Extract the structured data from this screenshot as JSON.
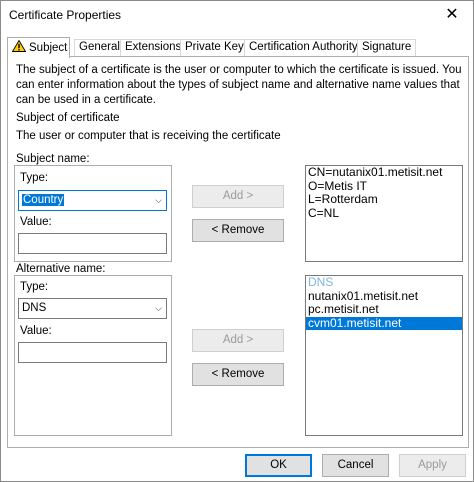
{
  "window": {
    "title": "Certificate Properties",
    "close_glyph": "✕"
  },
  "tabs": [
    {
      "label": "Subject",
      "active": true
    },
    {
      "label": "General"
    },
    {
      "label": "Extensions"
    },
    {
      "label": "Private Key"
    },
    {
      "label": "Certification Authority"
    },
    {
      "label": "Signature"
    }
  ],
  "subject": {
    "description_lines": [
      "The subject of a certificate is the user or computer to which the certificate is issued. You",
      "can enter information about the types of subject name and alternative name values that",
      "can be used in a certificate."
    ],
    "section_title": "Subject of certificate",
    "section_subtitle": "The user or computer that is receiving the certificate",
    "subject_name": {
      "label": "Subject name:",
      "type_label": "Type:",
      "type_value": "Country",
      "value_label": "Value:",
      "value": "",
      "add_button": "Add >",
      "remove_button": "< Remove",
      "entries": [
        "CN=nutanix01.metisit.net",
        "O=Metis IT",
        "L=Rotterdam",
        "C=NL"
      ]
    },
    "alternative_name": {
      "label": "Alternative name:",
      "type_label": "Type:",
      "type_value": "DNS",
      "value_label": "Value:",
      "value": "",
      "add_button": "Add >",
      "remove_button": "< Remove",
      "group_header": "DNS",
      "entries": [
        "nutanix01.metisit.net",
        "pc.metisit.net",
        "cvm01.metisit.net"
      ],
      "selected_entry": "cvm01.metisit.net"
    }
  },
  "footer": {
    "ok": "OK",
    "cancel": "Cancel",
    "apply": "Apply"
  },
  "icons": {
    "warning": "warning-icon",
    "dropdown": "chevron-down-icon"
  },
  "colors": {
    "accent": "#0078d7",
    "selection": "#0078d7",
    "group_header": "#7fb6e0"
  }
}
